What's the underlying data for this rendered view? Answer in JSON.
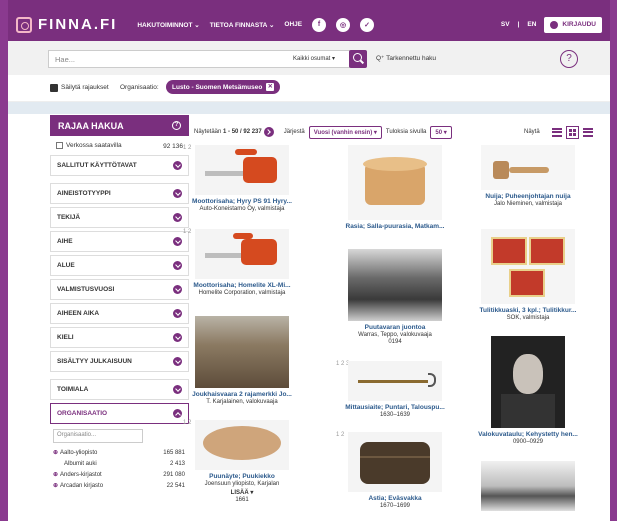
{
  "header": {
    "logo": "FINNA.FI",
    "nav": [
      "HAKUTOIMINNOT ⌄",
      "TIETOA FINNASTA ⌄",
      "OHJE"
    ],
    "social": [
      "f",
      "◎",
      "✓"
    ],
    "lang_sv": "SV",
    "lang_sep": "|",
    "lang_en": "EN",
    "login": "KIRJAUDU"
  },
  "search": {
    "placeholder": "Hae...",
    "type_select": "Kaikki osumat ▾",
    "advanced": "Q⁺ Tarkennettu haku",
    "help": "?"
  },
  "filters": {
    "keep": "Säilytä rajaukset",
    "org_label": "Organisaatio:",
    "org_value": "Lusto - Suomen Metsämuseo",
    "remove": "✕"
  },
  "sidebar": {
    "title": "RAJAA HAKUA",
    "online_label": "Verkossa saatavilla",
    "online_count": "92 136",
    "facets1": [
      "SALLITUT KÄYTTÖTAVAT"
    ],
    "facets2": [
      "AINEISTOTYYPPI",
      "TEKIJÄ",
      "AIHE",
      "ALUE",
      "VALMISTUSVUOSI",
      "AIHEEN AIKA",
      "KIELI",
      "SISÄLTYY JULKAISUUN"
    ],
    "facets3": [
      "TOIMIALA"
    ],
    "org_facet": "ORGANISAATIO",
    "org_placeholder": "Organisaatio...",
    "orgs": [
      {
        "plus": "⊕",
        "name": "Aalto-yliopisto",
        "count": "165 881",
        "indent": false
      },
      {
        "plus": "",
        "name": "Albumit auki",
        "count": "2 413",
        "indent": true
      },
      {
        "plus": "⊕",
        "name": "Anders-kirjastot",
        "count": "291 080",
        "indent": false
      },
      {
        "plus": "⊕",
        "name": "Arcadan kirjasto",
        "count": "22 541",
        "indent": false
      }
    ]
  },
  "results": {
    "showing": "Näytetään",
    "range": "1 - 50 / 92 237",
    "sort_label": "Järjestä",
    "sort_value": "Vuosi (vanhin ensin) ▾",
    "per_page_label": "Tuloksia sivulla",
    "per_page_value": "50 ▾",
    "view_label": "Näytä"
  },
  "cards": {
    "c1": {
      "nums": "1 2",
      "title": "Moottorisaha; Hyry PS 91 Hyry...",
      "sub": "Auto-Koneistamo Oy, valmistaja"
    },
    "c2": {
      "nums": "1 2",
      "title": "Moottorisaha; Homelite XL-Mi...",
      "sub": "Homelite Corporation, valmistaja"
    },
    "c3": {
      "nums": "",
      "title": "Joukhaisvaara 2 rajamerkki Jo...",
      "sub": "T. Karjalainen, valokuvaaja"
    },
    "c4": {
      "nums": "1 2",
      "title": "Puunäyte; Puukiekko",
      "sub": "Joensuun yliopisto, Karjalan",
      "more": "LISÄÄ ▾",
      "year": "1661"
    },
    "c5": {
      "nums": "",
      "title": "Rasia; Salla-puurasia, Matkam...",
      "sub": ""
    },
    "c6": {
      "nums": "",
      "title": "Puutavaran juontoa",
      "sub": "Warras, Teppo, valokuvaaja",
      "year": "0194"
    },
    "c7": {
      "nums": "1 2 3",
      "title": "Mittausiaite; Puntari, Talouspu...",
      "sub": "1630–1639"
    },
    "c8": {
      "nums": "1 2",
      "title": "Astia; Eväsvakka",
      "sub": "1670–1699"
    },
    "c9": {
      "nums": "",
      "title": "Nuija; Puheenjohtajan nuija",
      "sub": "Jalo Nieminen, valmistaja"
    },
    "c10": {
      "nums": "",
      "title": "Tulitikkuaski, 3 kpl.; Tulitikkur...",
      "sub": "SOK, valmistaja"
    },
    "c11": {
      "nums": "",
      "title": "Valokuvataulu; Kehystetty hen...",
      "sub": "0900–0929"
    }
  }
}
